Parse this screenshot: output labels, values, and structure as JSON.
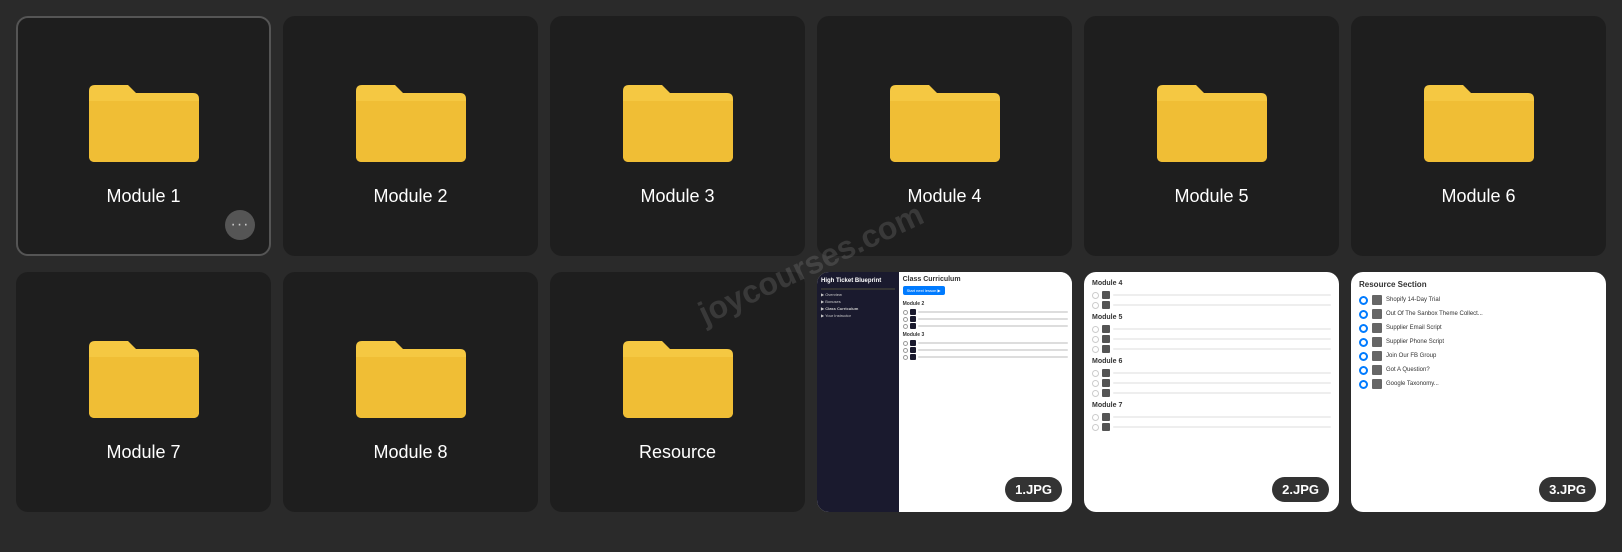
{
  "watermark": "joycourses.com",
  "row1": {
    "cards": [
      {
        "label": "Module 1",
        "hasMore": true,
        "active": true
      },
      {
        "label": "Module 2",
        "hasMore": false,
        "active": false
      },
      {
        "label": "Module 3",
        "hasMore": false,
        "active": false
      },
      {
        "label": "Module 4",
        "hasMore": false,
        "active": false
      },
      {
        "label": "Module 5",
        "hasMore": false,
        "active": false
      },
      {
        "label": "Module 6",
        "hasMore": false,
        "active": false
      }
    ]
  },
  "row2": {
    "cards": [
      {
        "type": "folder",
        "label": "Module 7"
      },
      {
        "type": "folder",
        "label": "Module 8"
      },
      {
        "type": "folder",
        "label": "Resource"
      },
      {
        "type": "preview",
        "label": "1.JPG"
      },
      {
        "type": "preview",
        "label": "2.JPG"
      },
      {
        "type": "preview",
        "label": "3.JPG"
      }
    ]
  },
  "preview3": {
    "title": "Resource Section",
    "items": [
      "Shopify 14-Day Trial",
      "Out Of The Sanbox Theme Collect...",
      "Supplier Email Script",
      "Supplier Phone Script",
      "Join Our FB Group",
      "Got A Question?"
    ]
  },
  "section_label": "Section"
}
